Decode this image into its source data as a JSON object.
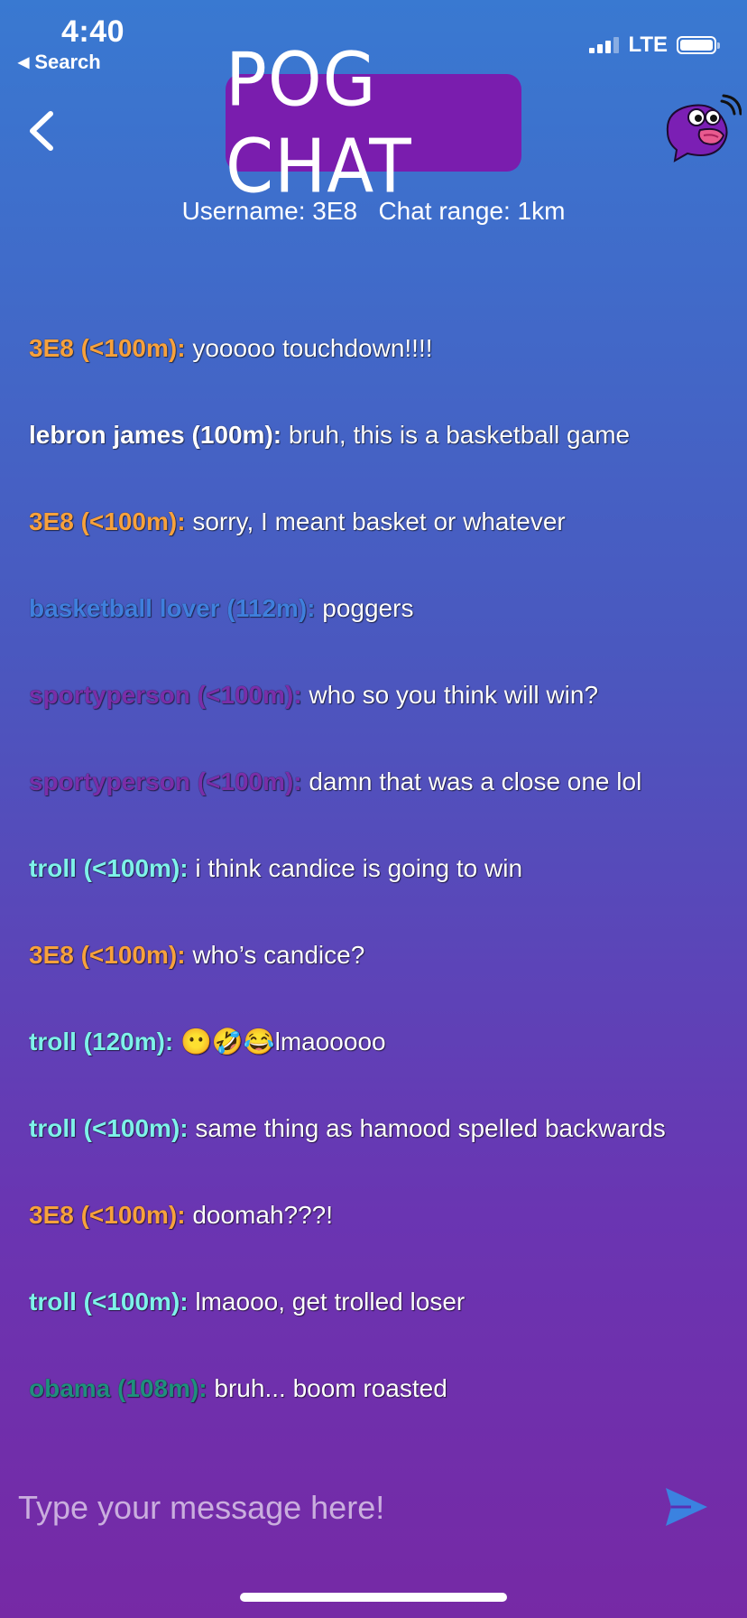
{
  "status_bar": {
    "time": "4:40",
    "back_label": "Search",
    "network": "LTE"
  },
  "header": {
    "logo_text": "POG CHAT",
    "user_info": "Username: 3E8   Chat range: 1km"
  },
  "colors": {
    "self": "#f7a13c",
    "white_user": "#ffffff",
    "blue_user": "#3f7fdc",
    "purple_user": "#7a2ea8",
    "cyan_user": "#7ef2ea",
    "green_user": "#1f8f7c",
    "accent": "#7a1dae",
    "send": "#3b82e0"
  },
  "messages": [
    {
      "author": "3E8 (<100m):",
      "text": " yooooo touchdown!!!!",
      "color": "#f7a13c"
    },
    {
      "author": "lebron james (100m):",
      "text": " bruh, this is a basketball game",
      "color": "#ffffff"
    },
    {
      "author": "3E8 (<100m):",
      "text": " sorry, I meant basket or whatever",
      "color": "#f7a13c"
    },
    {
      "author": "basketball lover (112m):",
      "text": " poggers",
      "color": "#3f7fdc"
    },
    {
      "author": "sportyperson (<100m):",
      "text": " who so you think will win?",
      "color": "#7a2ea8"
    },
    {
      "author": "sportyperson (<100m):",
      "text": " damn that was a close one lol",
      "color": "#7a2ea8"
    },
    {
      "author": "troll (<100m):",
      "text": " i think candice is going to win",
      "color": "#7ef2ea"
    },
    {
      "author": "3E8 (<100m):",
      "text": " who’s candice?",
      "color": "#f7a13c"
    },
    {
      "author": "troll (120m):",
      "text": " 😶🤣😂lmaooooo",
      "color": "#7ef2ea"
    },
    {
      "author": "troll (<100m):",
      "text": " same thing as hamood spelled backwards",
      "color": "#7ef2ea"
    },
    {
      "author": "3E8 (<100m):",
      "text": " doomah???!",
      "color": "#f7a13c"
    },
    {
      "author": "troll (<100m):",
      "text": " lmaooo, get trolled loser",
      "color": "#7ef2ea"
    },
    {
      "author": "obama (108m):",
      "text": " bruh... boom roasted",
      "color": "#1f8f7c"
    }
  ],
  "input": {
    "placeholder": "Type your message here!",
    "value": ""
  },
  "icons": {
    "back": "chevron-left-icon",
    "mascot": "mascot-icon",
    "send": "send-icon"
  }
}
